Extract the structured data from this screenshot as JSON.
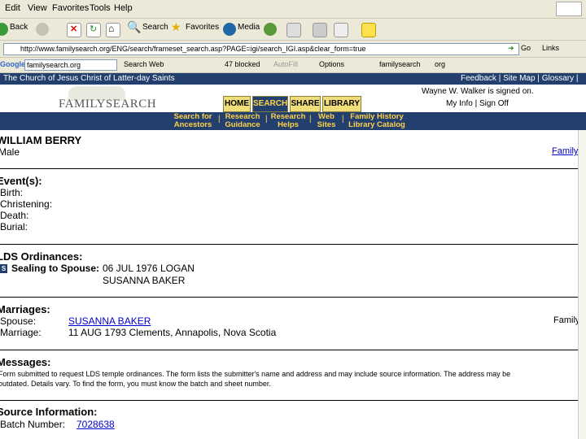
{
  "menu": [
    "Edit",
    "View",
    "Favorites",
    "Tools",
    "Help"
  ],
  "toolbar": {
    "back": "Back",
    "search": "Search",
    "favorites": "Favorites",
    "media": "Media"
  },
  "address": {
    "url": "http://www.familysearch.org/ENG/search/frameset_search.asp?PAGE=igi/search_IGI.asp&clear_form=true",
    "go": "Go",
    "links": "Links"
  },
  "google": {
    "label": "Google",
    "query": "familysearch.org",
    "search_web": "Search Web",
    "blocked": "47 blocked",
    "autofill": "AutoFill",
    "options": "Options",
    "q1": "familysearch",
    "q2": "org"
  },
  "church_bar": {
    "title": "The Church of Jesus Christ of Latter-day Saints",
    "links": "Feedback | Site Map | Glossary | Help"
  },
  "header": {
    "logo": "FAMILYSEARCH",
    "tabs": [
      "HOME",
      "SEARCH",
      "SHARE",
      "LIBRARY"
    ],
    "signed_in": "Wayne W. Walker is signed on.",
    "account": "My Info | Sign Off"
  },
  "subnav": [
    {
      "l1": "Search for",
      "l2": "Ancestors"
    },
    {
      "l1": "Research",
      "l2": "Guidance"
    },
    {
      "l1": "Research",
      "l2": "Helps"
    },
    {
      "l1": "Web",
      "l2": "Sites"
    },
    {
      "l1": "Family History",
      "l2": "Library Catalog"
    }
  ],
  "record": {
    "name": "WILLIAM BERRY",
    "sex": "Male",
    "family_link": "Family",
    "events_title": "Event(s):",
    "events": [
      "Birth:",
      "Christening:",
      "Death:",
      "Burial:"
    ],
    "ordinances_title": "LDS Ordinances:",
    "ordinance_code": "S",
    "ordinance_label": "Sealing to Spouse:",
    "ordinance_value1": "06 JUL 1976 LOGAN",
    "ordinance_value2": "SUSANNA BAKER",
    "marriages_title": "Marriages:",
    "spouse_label": "Spouse:",
    "spouse_value": "SUSANNA BAKER",
    "marriage_label": "Marriage:",
    "marriage_value": "11 AUG 1793 Clements, Annapolis, Nova Scotia",
    "family_link2": "Family",
    "messages_title": "Messages:",
    "message_line1": "Form submitted to request LDS temple ordinances. The form lists the submitter's name and address and may include source information. The address may be",
    "message_line2": "outdated. Details vary. To find the form, you must know the batch and sheet number.",
    "source_title": "Source Information:",
    "batch_label": "Batch Number:",
    "batch_value": "7028638"
  }
}
